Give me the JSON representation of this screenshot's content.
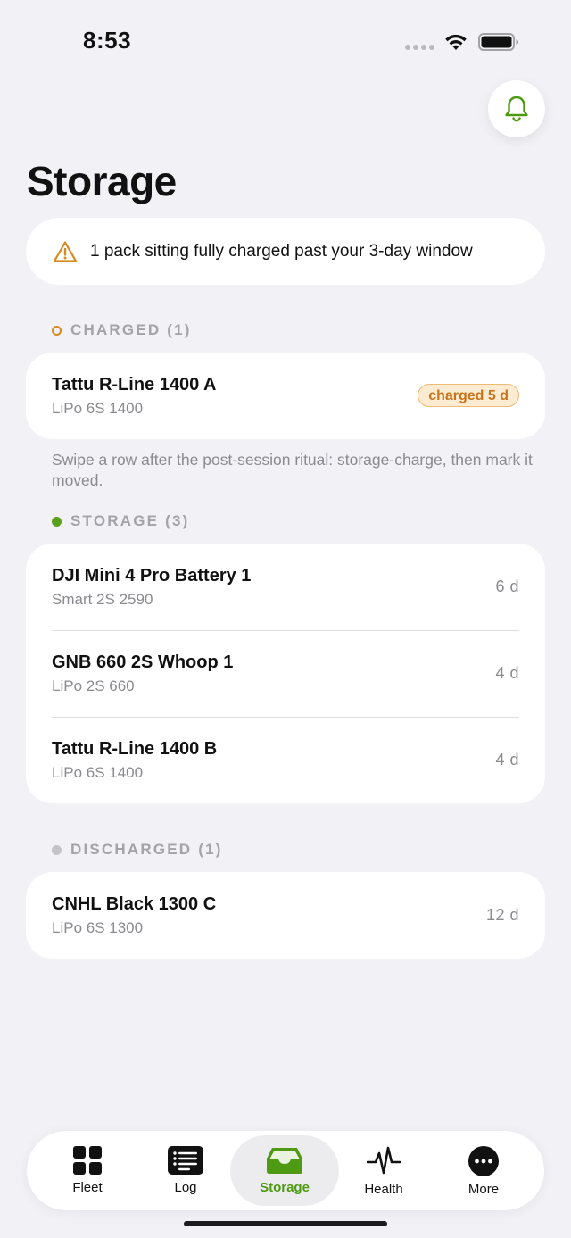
{
  "status_bar": {
    "time": "8:53"
  },
  "header": {
    "title": "Storage"
  },
  "alert": {
    "text": "1 pack sitting fully charged past your 3-day window",
    "icon": "warning-triangle-icon",
    "color": "#d98a1f"
  },
  "sections": {
    "charged": {
      "label": "CHARGED (1)",
      "color": "#d98a1f",
      "items": [
        {
          "name": "Tattu R-Line 1400 A",
          "sub": "LiPo 6S 1400",
          "badge": "charged 5 d"
        }
      ]
    },
    "hint": "Swipe a row after the post-session ritual: storage-charge, then mark it moved.",
    "storage": {
      "label": "STORAGE (3)",
      "color": "#5aa01e",
      "items": [
        {
          "name": "DJI Mini 4 Pro Battery 1",
          "sub": "Smart 2S 2590",
          "days": "6 d"
        },
        {
          "name": "GNB 660 2S Whoop 1",
          "sub": "LiPo 2S 660",
          "days": "4 d"
        },
        {
          "name": "Tattu R-Line 1400 B",
          "sub": "LiPo 6S 1400",
          "days": "4 d"
        }
      ]
    },
    "discharged": {
      "label": "DISCHARGED (1)",
      "color": "#c4c4c8",
      "items": [
        {
          "name": "CNHL Black 1300 C",
          "sub": "LiPo 6S 1300",
          "days": "12 d"
        }
      ]
    }
  },
  "tabs": [
    {
      "label": "Fleet",
      "icon": "grid-icon"
    },
    {
      "label": "Log",
      "icon": "list-icon"
    },
    {
      "label": "Storage",
      "icon": "tray-icon",
      "active": true
    },
    {
      "label": "Health",
      "icon": "pulse-icon"
    },
    {
      "label": "More",
      "icon": "more-icon"
    }
  ],
  "colors": {
    "accent": "#4e9a13",
    "background": "#f1f1f6"
  }
}
